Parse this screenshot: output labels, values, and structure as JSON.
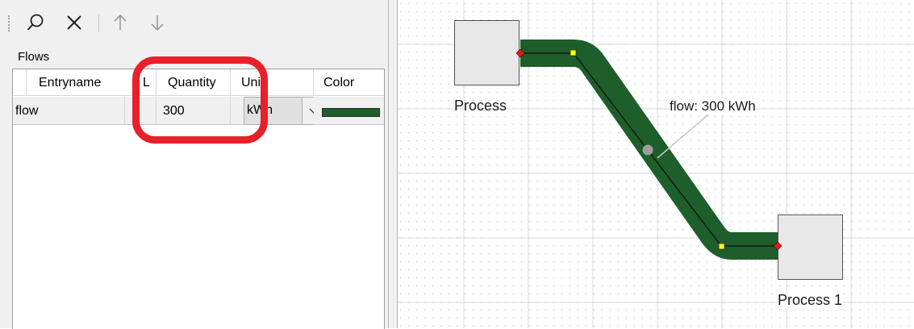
{
  "toolbar": {
    "search_icon": "magnifier",
    "delete_icon": "x",
    "move_up_icon": "arrow-up",
    "move_down_icon": "arrow-down"
  },
  "flows": {
    "section_label": "Flows",
    "columns": {
      "entryname": "Entryname",
      "l": "L",
      "quantity": "Quantity",
      "unit": "Unit",
      "color": "Color"
    },
    "rows": [
      {
        "entryname": "flow",
        "l": "",
        "quantity": "300",
        "unit": "kWh",
        "color": "#1d5e2a"
      }
    ]
  },
  "diagram": {
    "source_process": "Process",
    "target_process": "Process 1",
    "flow_label": "flow: 300 kWh",
    "flow_color": "#1d5e2a"
  },
  "highlight_color": "#e8202a"
}
